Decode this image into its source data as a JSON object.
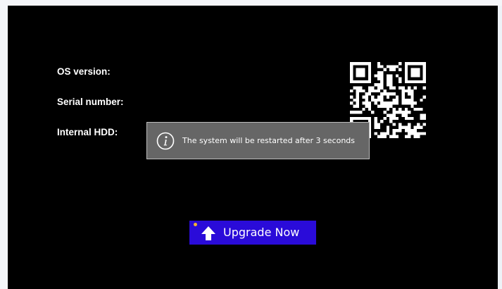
{
  "info": {
    "os_version_label": "OS version:",
    "serial_number_label": "Serial number:",
    "internal_hdd_label": "Internal HDD:"
  },
  "qr_code": {
    "icon": "qr-code-icon"
  },
  "toast": {
    "icon": "info-icon",
    "message": "The system will be restarted after 3 seconds"
  },
  "upgrade": {
    "icon": "up-arrow-icon",
    "label": "Upgrade Now"
  },
  "colors": {
    "screen_background": "#000000",
    "toast_background": "#666666",
    "upgrade_button": "#2a0bd9",
    "text": "#ffffff"
  }
}
